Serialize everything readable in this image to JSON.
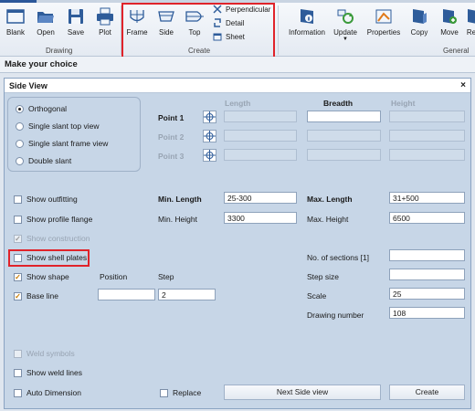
{
  "ribbon": {
    "buttons": {
      "blank": "Blank",
      "open": "Open",
      "save": "Save",
      "plot": "Plot",
      "frame": "Frame",
      "side": "Side",
      "top": "Top",
      "perpendicular": "Perpendicular",
      "detail": "Detail",
      "sheet": "Sheet",
      "information": "Information",
      "update": "Update",
      "properties": "Properties",
      "copy": "Copy",
      "move": "Move",
      "re": "Re"
    },
    "groups": {
      "drawing": "Drawing",
      "create": "Create",
      "general": "General"
    }
  },
  "command_bar": {
    "prompt": "Make your choice"
  },
  "dialog": {
    "title": "Side View",
    "close_glyph": "×",
    "radios": [
      {
        "label": "Orthogonal",
        "selected": true
      },
      {
        "label": "Single slant top view",
        "selected": false
      },
      {
        "label": "Single slant frame view",
        "selected": false
      },
      {
        "label": "Double slant",
        "selected": false
      }
    ],
    "columns": {
      "length": "Length",
      "breadth": "Breadth",
      "height": "Height"
    },
    "points": {
      "p1": "Point 1",
      "p2": "Point 2",
      "p3": "Point 3"
    },
    "checkboxes": {
      "show_outfitting": {
        "label": "Show outfitting",
        "checked": false
      },
      "show_profile_flange": {
        "label": "Show profile flange",
        "checked": false
      },
      "show_construction": {
        "label": "Show construction",
        "checked": true,
        "disabled": true
      },
      "show_shell_plates": {
        "label": "Show shell plates",
        "checked": false
      },
      "show_shape": {
        "label": "Show shape",
        "checked": true
      },
      "base_line": {
        "label": "Base line",
        "checked": true
      },
      "weld_symbols": {
        "label": "Weld symbols",
        "checked": false,
        "disabled": true
      },
      "show_weld_lines": {
        "label": "Show weld lines",
        "checked": false
      },
      "auto_dimension": {
        "label": "Auto Dimension",
        "checked": false
      },
      "replace": {
        "label": "Replace",
        "checked": false
      }
    },
    "labels": {
      "position": "Position",
      "step": "Step",
      "min_length": "Min. Length",
      "min_height": "Min. Height",
      "max_length": "Max. Length",
      "max_height": "Max. Height",
      "no_sections": "No. of sections [1]",
      "step_size": "Step size",
      "scale": "Scale",
      "drawing_number": "Drawing number"
    },
    "values": {
      "min_length": "25-300",
      "min_height": "3300",
      "max_length": "31+500",
      "max_height": "6500",
      "position": "",
      "step": "2",
      "no_sections": "",
      "step_size": "",
      "scale": "25",
      "drawing_number": "108"
    },
    "buttons": {
      "next_side_view": "Next Side view",
      "create": "Create"
    },
    "check_glyph": "✓"
  },
  "colors": {
    "highlight": "#e0232a",
    "accent": "#2b579a"
  }
}
